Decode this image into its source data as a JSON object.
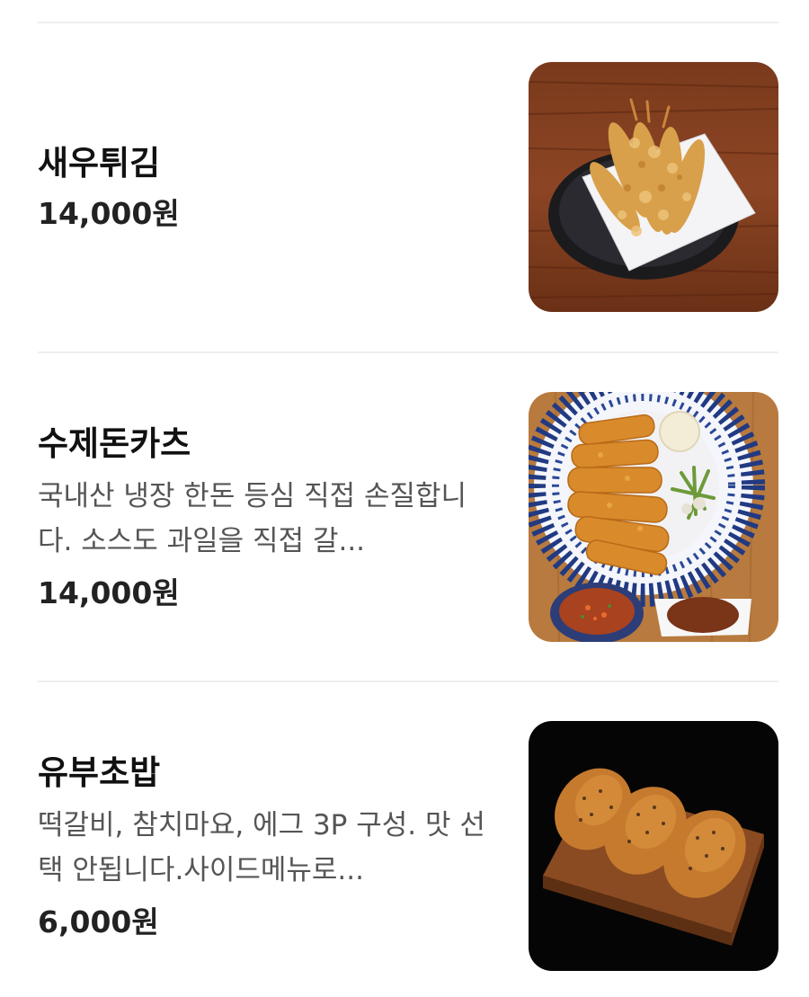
{
  "menu": {
    "items": [
      {
        "name": "새우튀김",
        "price": "14,000원"
      },
      {
        "name": "수제돈카츠",
        "description": "국내산 냉장 한돈 등심 직접 손질합니다. 소스도 과일을 직접 갈...",
        "price": "14,000원"
      },
      {
        "name": "유부초밥",
        "description": "떡갈비, 참치마요, 에그 3P 구성. 맛 선택 안됩니다.사이드메뉴로...",
        "price": "6,000원"
      }
    ]
  },
  "colors": {
    "divider": "#eeeeee",
    "name_text": "#111111",
    "description_text": "#555555",
    "price_text": "#222222"
  }
}
